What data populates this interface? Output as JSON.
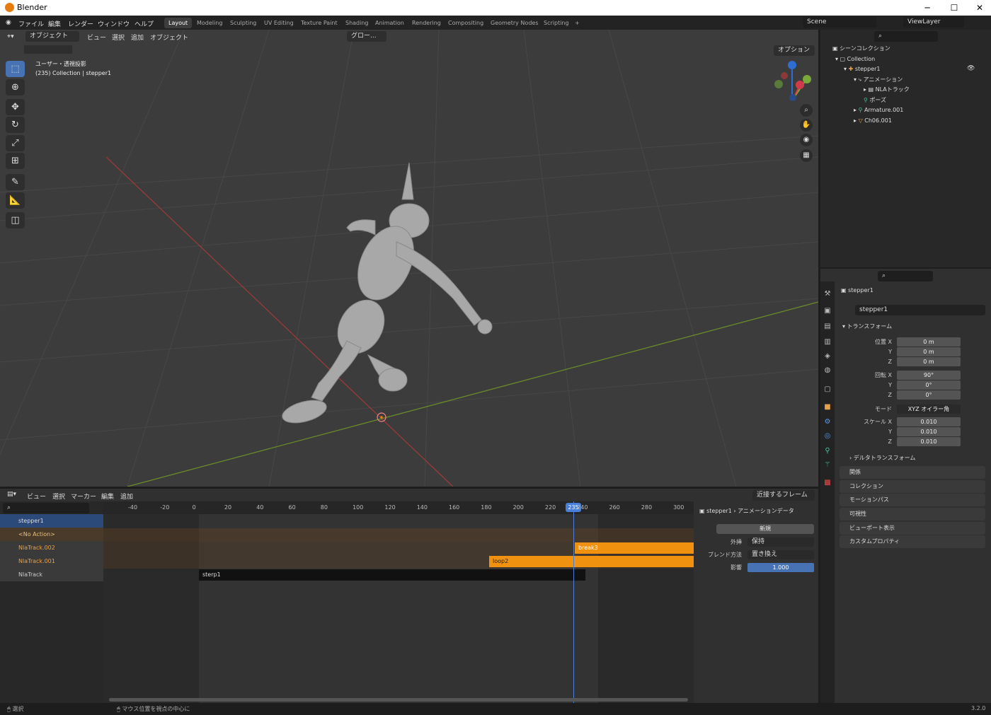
{
  "window": {
    "title": "Blender",
    "min": "─",
    "max": "☐",
    "close": "✕"
  },
  "menu": [
    "ファイル",
    "編集",
    "レンダー",
    "ウィンドウ",
    "ヘルプ"
  ],
  "workspaces": [
    "Layout",
    "Modeling",
    "Sculpting",
    "UV Editing",
    "Texture Paint",
    "Shading",
    "Animation",
    "Rendering",
    "Compositing",
    "Geometry Nodes",
    "Scripting",
    "+"
  ],
  "scene": "Scene",
  "viewlayer": "ViewLayer",
  "viewport": {
    "mode": "オブジェクト",
    "menus": [
      "ビュー",
      "選択",
      "追加",
      "オブジェクト"
    ],
    "transform_orient": "グロー...",
    "options": "オプション",
    "view_name": "ユーザー・透視投影",
    "info": "(235) Collection | stepper1"
  },
  "outliner": {
    "root": "シーンコレクション",
    "rows": [
      {
        "label": "Collection"
      },
      {
        "label": "stepper1"
      },
      {
        "label": "アニメーション"
      },
      {
        "label": "NLAトラック"
      },
      {
        "label": "ポーズ"
      },
      {
        "label": "Armature.001"
      },
      {
        "label": "Ch06.001"
      }
    ]
  },
  "properties": {
    "object": "stepper1",
    "datablock": "stepper1",
    "transform_label": "トランスフォーム",
    "rows": [
      {
        "label": "位置 X",
        "value": "0 m"
      },
      {
        "label": "Y",
        "value": "0 m"
      },
      {
        "label": "Z",
        "value": "0 m"
      },
      {
        "label": "回転 X",
        "value": "90°"
      },
      {
        "label": "Y",
        "value": "0°"
      },
      {
        "label": "Z",
        "value": "0°"
      },
      {
        "label": "モード",
        "value": "XYZ オイラー角"
      },
      {
        "label": "スケール X",
        "value": "0.010"
      },
      {
        "label": "Y",
        "value": "0.010"
      },
      {
        "label": "Z",
        "value": "0.010"
      }
    ],
    "delta": "デルタトランスフォーム",
    "sections": [
      "関係",
      "コレクション",
      "モーションパス",
      "可視性",
      "ビューポート表示",
      "カスタムプロパティ"
    ]
  },
  "nla": {
    "menus": [
      "ビュー",
      "選択",
      "マーカー",
      "編集",
      "追加"
    ],
    "snap": "近接するフレーム",
    "ticks": [
      "-40",
      "-20",
      "0",
      "20",
      "40",
      "60",
      "80",
      "100",
      "120",
      "140",
      "160",
      "180",
      "200",
      "220",
      "240",
      "260",
      "280",
      "300"
    ],
    "current_frame": "235",
    "tracks": [
      {
        "name": "stepper1"
      },
      {
        "name": "<No Action>"
      },
      {
        "name": "NlaTrack.002"
      },
      {
        "name": "NlaTrack.001"
      },
      {
        "name": "NlaTrack"
      }
    ],
    "strips": [
      {
        "name": "break3"
      },
      {
        "name": "loop2"
      },
      {
        "name": "sterp1"
      }
    ],
    "side": {
      "object": "stepper1",
      "anim": "アニメーションデータ",
      "new": "新規",
      "extrap_label": "外挿",
      "extrap": "保持",
      "blend_label": "ブレンド方法",
      "blend": "置き換え",
      "influence_label": "影響",
      "influence": "1.000"
    }
  },
  "status": {
    "left": "選択",
    "mid": "マウス位置を視点の中心に",
    "version": "3.2.0"
  }
}
